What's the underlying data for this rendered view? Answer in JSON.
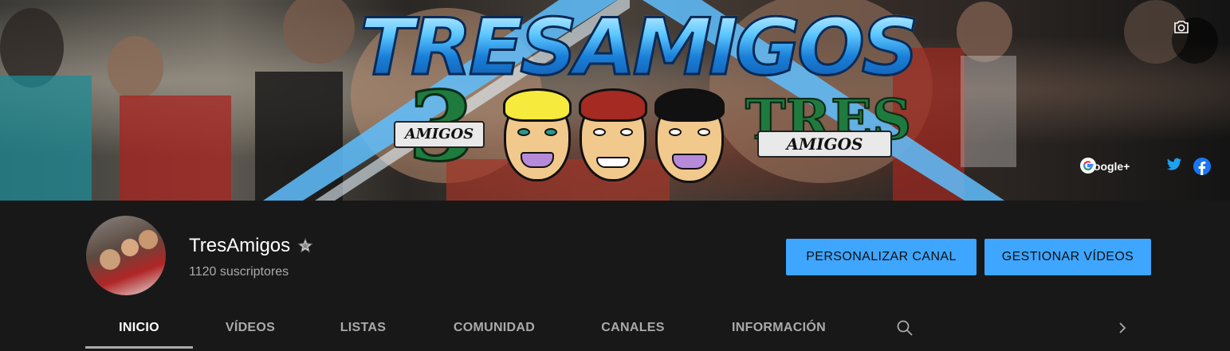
{
  "banner": {
    "title": "TRESAMIGOS",
    "logo_left_big": "3",
    "logo_left_ribbon": "AMIGOS",
    "logo_right_big": "TRES",
    "logo_right_ribbon": "AMIGOS",
    "camera_icon": "camera-icon",
    "social_links": [
      {
        "icon": "google-icon",
        "label": "Google+"
      },
      {
        "icon": "twitter-icon",
        "label": ""
      },
      {
        "icon": "facebook-icon",
        "label": ""
      }
    ]
  },
  "channel": {
    "name": "TresAmigos",
    "verified_icon": "verified-star-icon",
    "subscribers": "1120 suscriptores"
  },
  "actions": {
    "customize_label": "PERSONALIZAR CANAL",
    "manage_label": "GESTIONAR VÍDEOS"
  },
  "tabs": [
    {
      "label": "INICIO",
      "active": true
    },
    {
      "label": "VÍDEOS",
      "active": false
    },
    {
      "label": "LISTAS",
      "active": false
    },
    {
      "label": "COMUNIDAD",
      "active": false
    },
    {
      "label": "CANALES",
      "active": false
    },
    {
      "label": "INFORMACIÓN",
      "active": false
    }
  ],
  "colors": {
    "background": "#181818",
    "accent_button": "#3ea6ff",
    "tab_inactive": "#aaaaaa",
    "tab_active": "#ffffff"
  }
}
